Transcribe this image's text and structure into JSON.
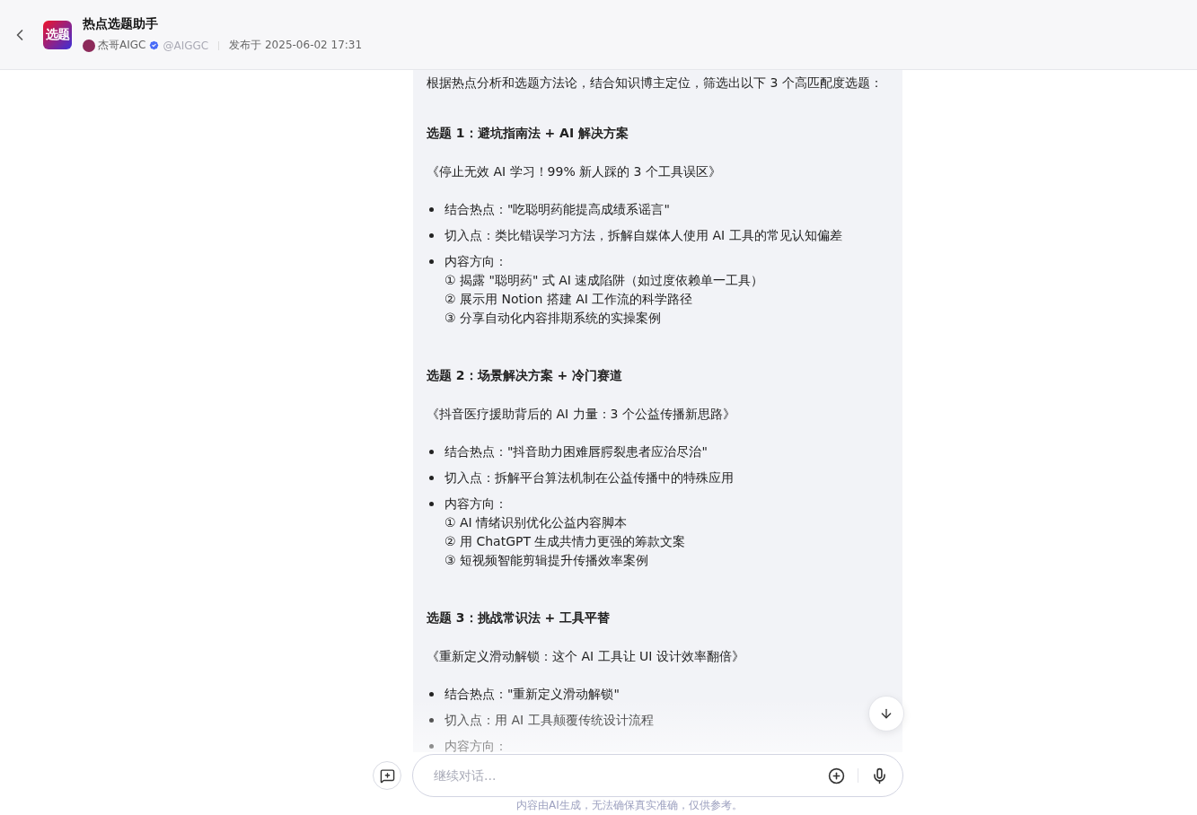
{
  "header": {
    "logo_text": "选题",
    "title": "热点选题助手",
    "author": "杰哥AIGC",
    "verified": true,
    "handle": "@AIGGC",
    "published": "发布于 2025-06-02 17:31"
  },
  "message": {
    "intro": "根据热点分析和选题方法论，结合知识博主定位，筛选出以下 3 个高匹配度选题：",
    "topics": [
      {
        "heading": "选题 1：避坑指南法 + AI 解决方案",
        "title": "《停止无效 AI 学习！99% 新人踩的 3 个工具误区》",
        "points": [
          {
            "text": "结合热点：\"吃聪明药能提高成绩系谣言\""
          },
          {
            "text": "切入点：类比错误学习方法，拆解自媒体人使用 AI 工具的常见认知偏差"
          },
          {
            "text": "内容方向：",
            "subitems": [
              "① 揭露 \"聪明药\" 式 AI 速成陷阱（如过度依赖单一工具）",
              "② 展示用 Notion 搭建 AI 工作流的科学路径",
              "③ 分享自动化内容排期系统的实操案例"
            ]
          }
        ]
      },
      {
        "heading": "选题 2：场景解决方案 + 冷门赛道",
        "title": "《抖音医疗援助背后的 AI 力量：3 个公益传播新思路》",
        "points": [
          {
            "text": "结合热点：\"抖音助力困难唇腭裂患者应治尽治\""
          },
          {
            "text": "切入点：拆解平台算法机制在公益传播中的特殊应用"
          },
          {
            "text": "内容方向：",
            "subitems": [
              "① AI 情绪识别优化公益内容脚本",
              "② 用 ChatGPT 生成共情力更强的筹款文案",
              "③ 短视频智能剪辑提升传播效率案例"
            ]
          }
        ]
      },
      {
        "heading": "选题 3：挑战常识法 + 工具平替",
        "title": "《重新定义滑动解锁：这个 AI 工具让 UI 设计效率翻倍》",
        "points": [
          {
            "text": "结合热点：\"重新定义滑动解锁\""
          },
          {
            "text": "切入点：用 AI 工具颠覆传统设计流程"
          },
          {
            "text": "内容方向："
          }
        ]
      }
    ]
  },
  "composer": {
    "placeholder": "继续对话...",
    "disclaimer": "内容由AI生成，无法确保真实准确，仅供参考。"
  }
}
